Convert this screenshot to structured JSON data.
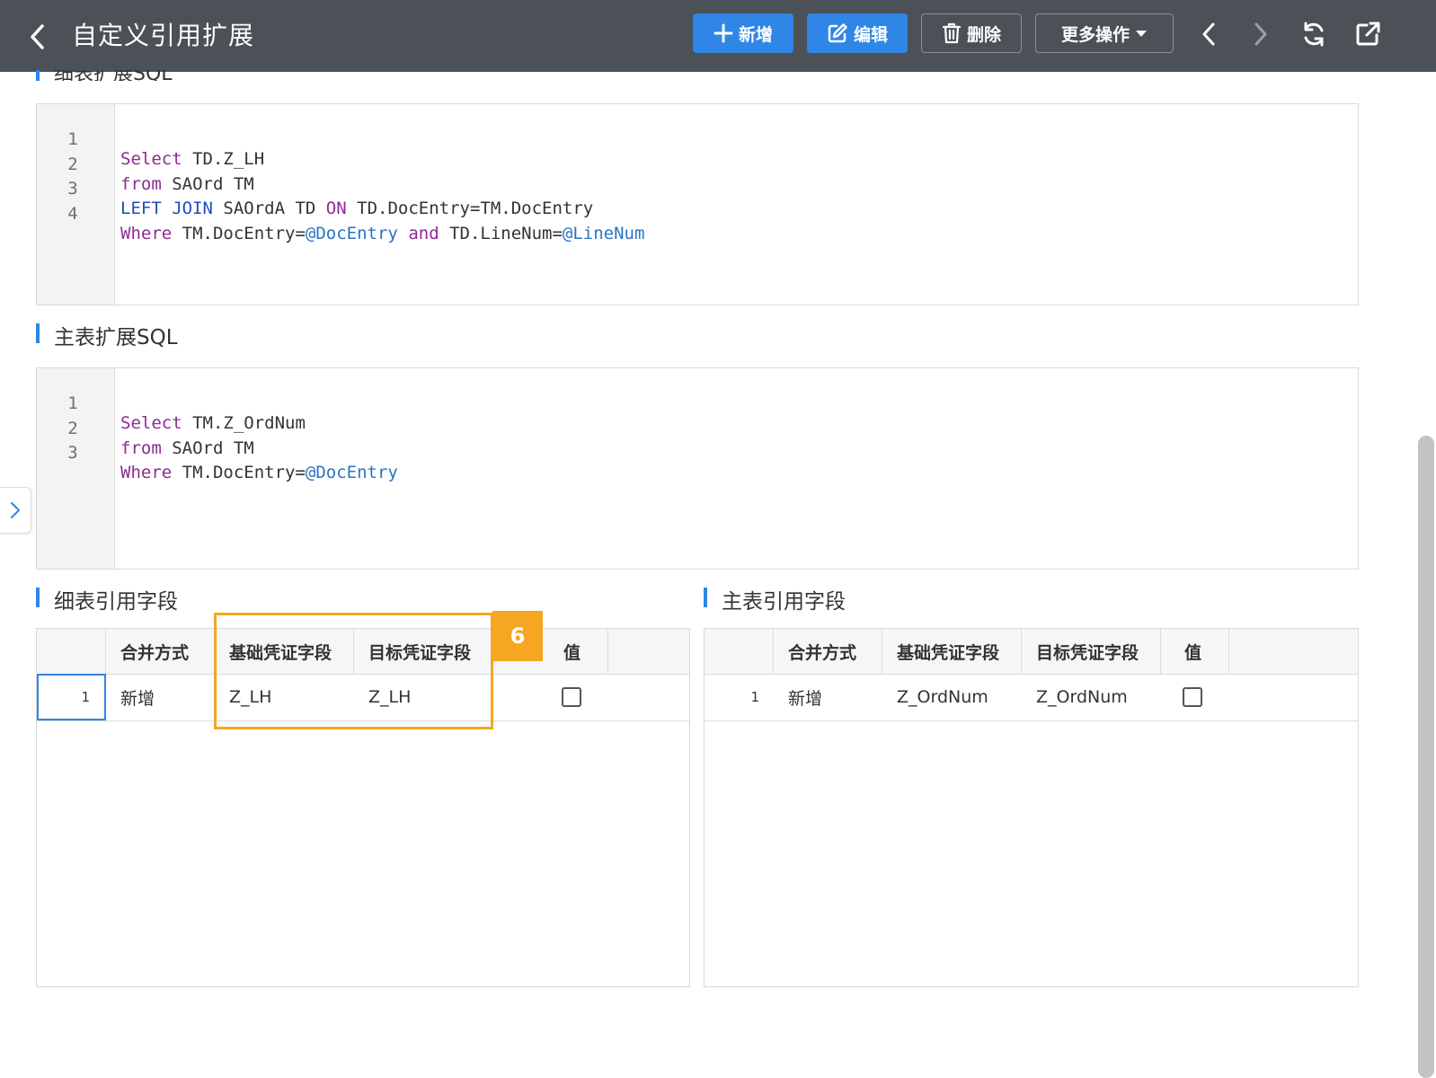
{
  "header": {
    "title": "自定义引用扩展",
    "buttons": {
      "add": "新增",
      "edit": "编辑",
      "delete": "删除",
      "more": "更多操作"
    }
  },
  "sections": {
    "detail_sql_title": "细表扩展SQL",
    "main_sql_title": "主表扩展SQL",
    "detail_fields_title": "细表引用字段",
    "main_fields_title": "主表引用字段"
  },
  "detail_sql": {
    "line_numbers": [
      "1",
      "2",
      "3",
      "4"
    ],
    "l1": {
      "kw": "Select",
      "rest": " TD.Z_LH"
    },
    "l2": {
      "kw": "from",
      "rest": " SAOrd TM"
    },
    "l3": {
      "kw": "LEFT JOIN",
      "mid": " SAOrdA TD ",
      "kw2": "ON",
      "rest": " TD.DocEntry=TM.DocEntry"
    },
    "l4": {
      "kw": "Where",
      "mid": " TM.DocEntry=",
      "var1": "@DocEntry",
      "and": " and",
      "mid2": " TD.LineNum=",
      "var2": "@LineNum"
    }
  },
  "main_sql": {
    "line_numbers": [
      "1",
      "2",
      "3"
    ],
    "l1": {
      "kw": "Select",
      "rest": " TM.Z_OrdNum"
    },
    "l2": {
      "kw": "from",
      "rest": " SAOrd TM"
    },
    "l3": {
      "kw": "Where",
      "mid": " TM.DocEntry=",
      "var1": "@DocEntry"
    }
  },
  "grid_headers": [
    "合并方式",
    "基础凭证字段",
    "目标凭证字段",
    "值"
  ],
  "detail_grid": {
    "rows": [
      {
        "num": "1",
        "merge": "新增",
        "base": "Z_LH",
        "target": "Z_LH",
        "value_checked": false
      }
    ]
  },
  "main_grid": {
    "rows": [
      {
        "num": "1",
        "merge": "新增",
        "base": "Z_OrdNum",
        "target": "Z_OrdNum",
        "value_checked": false
      }
    ]
  },
  "callout": {
    "label": "6"
  },
  "colors": {
    "header_bg": "#4b5157",
    "primary": "#2f86e6",
    "callout": "#f5a623"
  }
}
